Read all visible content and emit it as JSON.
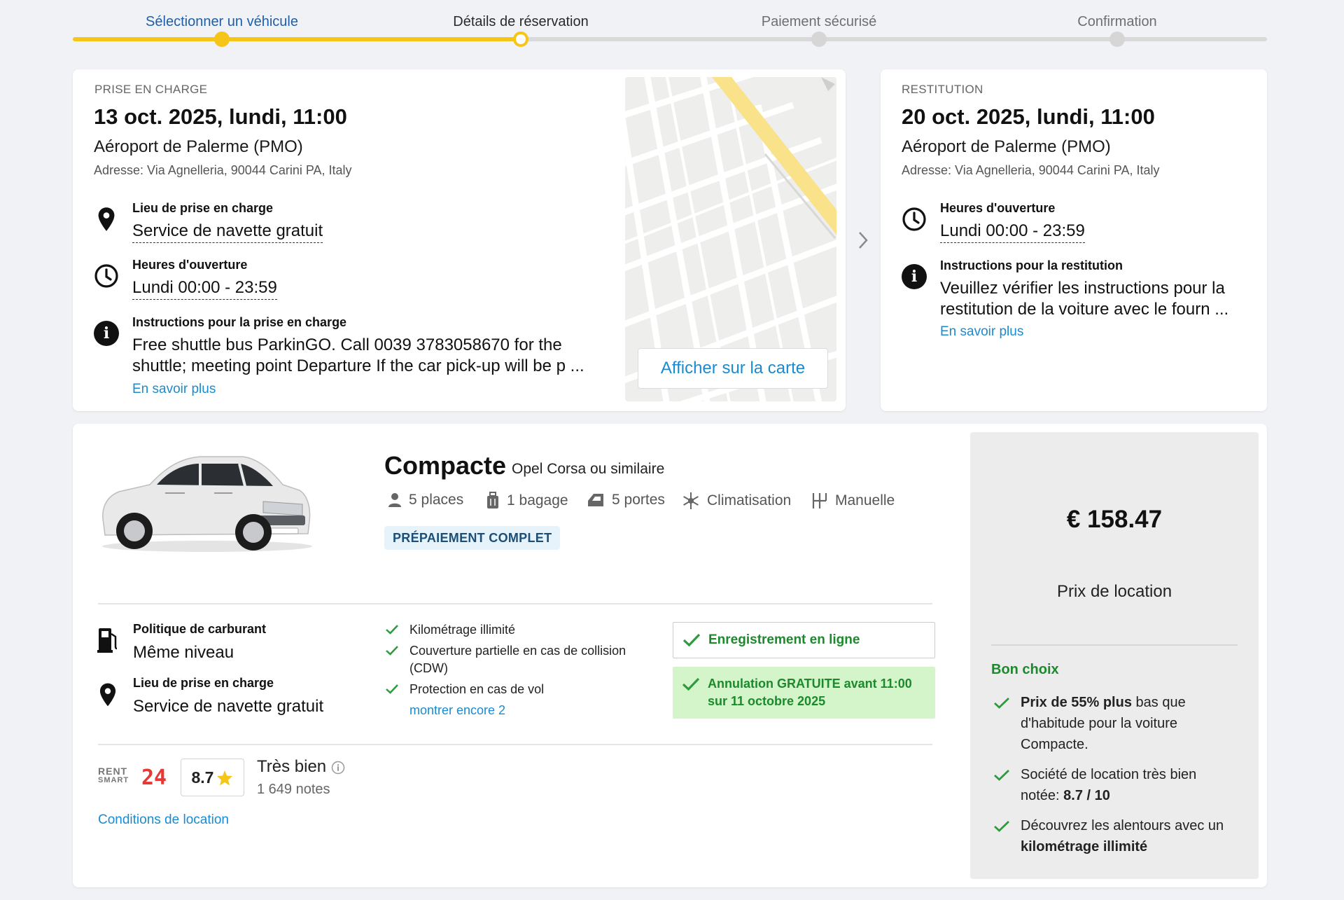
{
  "stepper": {
    "steps": [
      {
        "label": "Sélectionner un véhicule"
      },
      {
        "label": "Détails de réservation"
      },
      {
        "label": "Paiement sécurisé"
      },
      {
        "label": "Confirmation"
      }
    ]
  },
  "pickup": {
    "heading": "PRISE EN CHARGE",
    "date": "13 oct. 2025, lundi, 11:00",
    "location": "Aéroport de Palerme (PMO)",
    "address": "Adresse: Via Agnelleria, 90044 Carini PA, Italy",
    "place_title": "Lieu de prise en charge",
    "place_value": "Service de navette gratuit",
    "hours_title": "Heures d'ouverture",
    "hours_value": "Lundi 00:00 - 23:59",
    "instructions_title": "Instructions pour la prise en charge",
    "instructions_line1": "Free shuttle bus ParkinGO. Call 0039 3783058670 for the",
    "instructions_line2": "shuttle; meeting point Departure If the car pick-up will be p ...",
    "more_link": "En savoir plus",
    "map_button": "Afficher sur la carte"
  },
  "return": {
    "heading": "RESTITUTION",
    "date": "20 oct. 2025, lundi, 11:00",
    "location": "Aéroport de Palerme (PMO)",
    "address": "Adresse: Via Agnelleria, 90044 Carini PA, Italy",
    "hours_title": "Heures d'ouverture",
    "hours_value": "Lundi 00:00 - 23:59",
    "instructions_title": "Instructions pour la restitution",
    "instructions_line1": "Veuillez vérifier les instructions pour la",
    "instructions_line2": "restitution de la voiture avec le fourn ...",
    "more_link": "En savoir plus"
  },
  "car": {
    "category": "Compacte",
    "model": "Opel Corsa ou similaire",
    "features": {
      "seats": "5 places",
      "bags": "1 bagage",
      "doors": "5 portes",
      "ac": "Climatisation",
      "transmission": "Manuelle"
    },
    "badge": "PRÉPAIEMENT COMPLET",
    "fuel_title": "Politique de carburant",
    "fuel_value": "Même niveau",
    "place_title": "Lieu de prise en charge",
    "place_value": "Service de navette gratuit",
    "inclusions": {
      "item1": "Kilométrage illimité",
      "item2_line1": "Couverture partielle en cas de collision",
      "item2_line2": "(CDW)",
      "item3": "Protection en cas de vol",
      "more": "montrer encore 2"
    },
    "online_checkin": "Enregistrement en ligne",
    "free_cancel_line1": "Annulation GRATUITE avant 11:00",
    "free_cancel_line2": "sur 11 octobre 2025",
    "supplier_logo_top": "RENT",
    "supplier_logo_bottom": "SMART",
    "supplier_logo_num": "24",
    "rating_value": "8.7",
    "rating_label": "Très bien",
    "rating_count": "1 649 notes",
    "conditions_link": "Conditions de location"
  },
  "price": {
    "amount": "€ 158.47",
    "label": "Prix de location",
    "good_choice": "Bon choix",
    "b1_bold": "Prix de 55% plus",
    "b1_rest1": " bas que",
    "b1_rest2": "d'habitude pour la voiture",
    "b1_rest3": "Compacte.",
    "b2_line1": "Société de location très bien",
    "b2_line2_pre": "notée: ",
    "b2_line2_bold": "8.7 / 10",
    "b3_line1": "Découvrez les alentours avec un",
    "b3_bold": "kilométrage illimité"
  },
  "colors": {
    "accent_yellow": "#f5c518",
    "link_blue": "#1a8bd0",
    "success_green": "#2e9a3e"
  }
}
